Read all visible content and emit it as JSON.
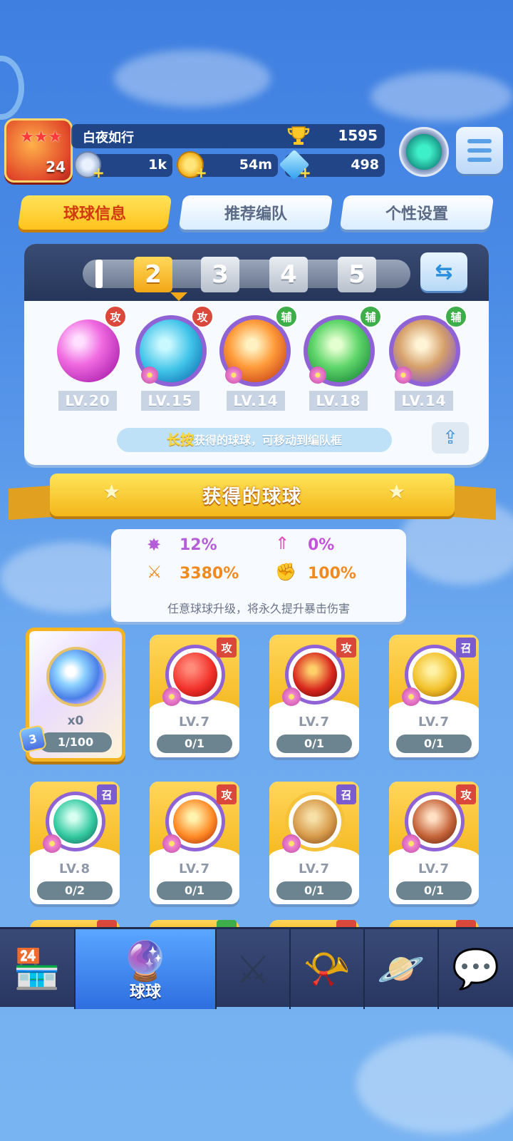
{
  "player": {
    "name": "白夜如行",
    "level": "24",
    "trophies": "1595",
    "coins": "1k",
    "gold": "54m",
    "gems": "498"
  },
  "tabs": [
    {
      "label": "球球信息",
      "active": true
    },
    {
      "label": "推荐编队",
      "active": false
    },
    {
      "label": "个性设置",
      "active": false
    }
  ],
  "team": {
    "slots": [
      "2",
      "3",
      "4",
      "5"
    ],
    "active_slot": "2",
    "balls": [
      {
        "level": "LV.20",
        "tag": "攻",
        "type": "atk"
      },
      {
        "level": "LV.15",
        "tag": "攻",
        "type": "atk"
      },
      {
        "level": "LV.14",
        "tag": "辅",
        "type": "sup"
      },
      {
        "level": "LV.18",
        "tag": "辅",
        "type": "sup"
      },
      {
        "level": "LV.14",
        "tag": "辅",
        "type": "sup"
      }
    ],
    "hint_strong": "长按",
    "hint_rest": "获得的球球，可移动到编队框"
  },
  "section": {
    "title": "获得的球球"
  },
  "stats": {
    "crit_rate": "12%",
    "crit_bonus": "0%",
    "crit_damage": "3380%",
    "extra": "100%",
    "note": "任意球球升级，将永久提升暴击伤害"
  },
  "special_card": {
    "count": "x0",
    "progress": "1/100",
    "badge": "3"
  },
  "cards": [
    {
      "level": "LV.7",
      "progress": "0/1",
      "tag": "攻",
      "type": "atk"
    },
    {
      "level": "LV.7",
      "progress": "0/1",
      "tag": "攻",
      "type": "atk"
    },
    {
      "level": "LV.7",
      "progress": "0/1",
      "tag": "召",
      "type": "sum"
    },
    {
      "level": "LV.8",
      "progress": "0/2",
      "tag": "召",
      "type": "sum"
    },
    {
      "level": "LV.7",
      "progress": "0/1",
      "tag": "攻",
      "type": "atk"
    },
    {
      "level": "LV.7",
      "progress": "0/1",
      "tag": "召",
      "type": "sum"
    },
    {
      "level": "LV.7",
      "progress": "0/1",
      "tag": "攻",
      "type": "atk"
    }
  ],
  "nav": {
    "items": [
      "shop",
      "balls",
      "battle",
      "whistle",
      "planet",
      "social"
    ],
    "active_label": "球球"
  }
}
